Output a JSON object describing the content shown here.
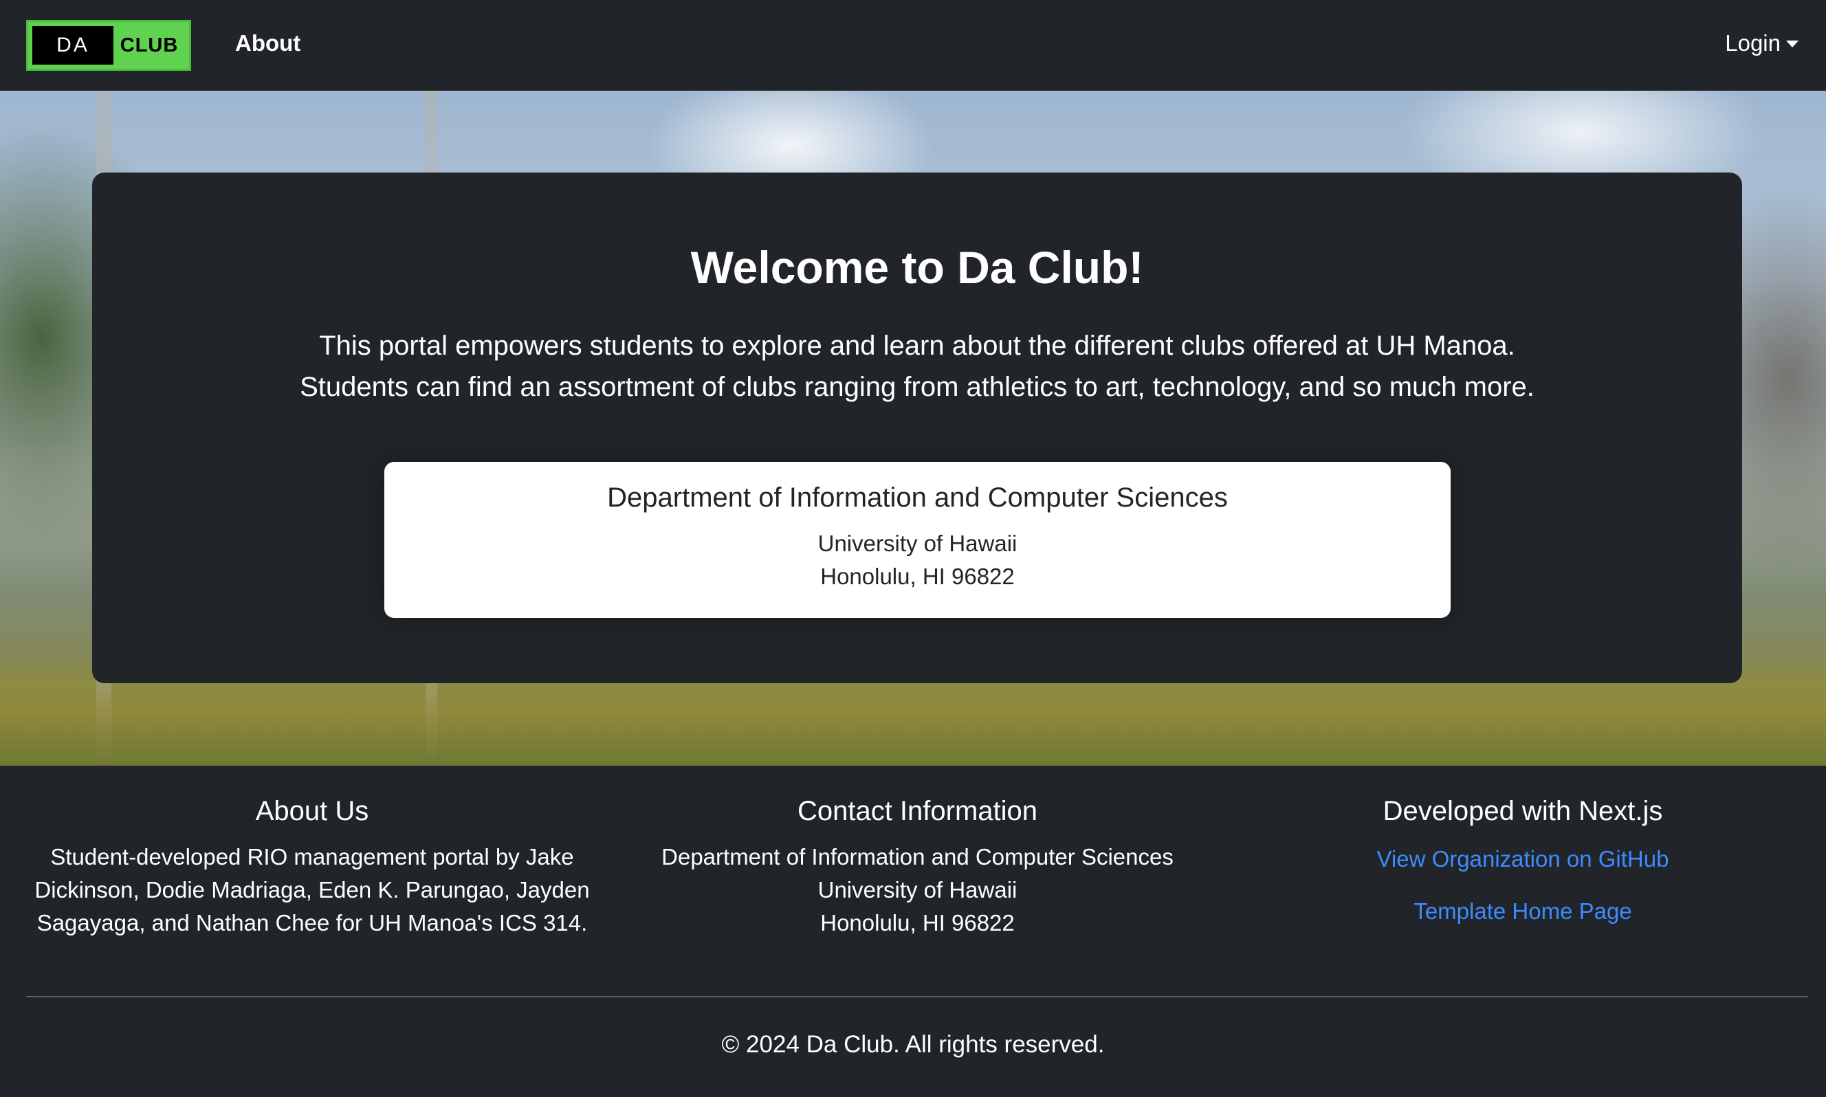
{
  "navbar": {
    "logo": {
      "da": "DA",
      "club": "CLUB"
    },
    "about_label": "About",
    "login_label": "Login"
  },
  "hero": {
    "title": "Welcome to Da Club!",
    "text_line1": "This portal empowers students to explore and learn about the different clubs offered at UH Manoa.",
    "text_line2": "Students can find an assortment of clubs ranging from athletics to art, technology, and so much more.",
    "info": {
      "department": "Department of Information and Computer Sciences",
      "university": "University of Hawaii",
      "address": "Honolulu, HI 96822"
    }
  },
  "footer": {
    "about": {
      "heading": "About Us",
      "line1": "Student-developed RIO management portal by Jake",
      "line2": "Dickinson, Dodie Madriaga, Eden K. Parungao, Jayden",
      "line3": "Sagayaga, and Nathan Chee for UH Manoa's ICS 314."
    },
    "contact": {
      "heading": "Contact Information",
      "department": "Department of Information and Computer Sciences",
      "university": "University of Hawaii",
      "address": "Honolulu, HI 96822"
    },
    "developed": {
      "heading": "Developed with Next.js",
      "github_link": "View Organization on GitHub",
      "template_link": "Template Home Page"
    },
    "copyright": "© 2024 Da Club. All rights reserved."
  },
  "colors": {
    "background": "#212529",
    "logo_green": "#5fd34f",
    "link_blue": "#3d8bfd"
  }
}
